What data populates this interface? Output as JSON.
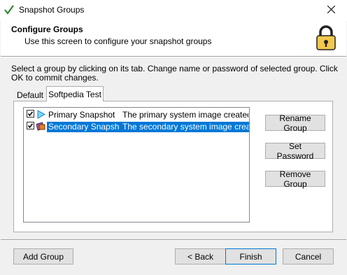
{
  "window": {
    "title": "Snapshot Groups",
    "close_icon": "close-icon",
    "app_icon": "checkmark-icon"
  },
  "header": {
    "title": "Configure Groups",
    "subtitle": "Use this screen to configure your snapshot groups",
    "icon": "lock-icon"
  },
  "instructions": "Select a group by clicking on its tab. Change name or password of selected group. Click OK to commit changes.",
  "tabs": [
    {
      "label": "Default",
      "selected": false
    },
    {
      "label": "Softpedia Test",
      "selected": true
    }
  ],
  "snapshots": [
    {
      "checked": true,
      "name": "Primary Snapshot",
      "description": "The primary system image created ...",
      "selected": false,
      "icon": "play-icon"
    },
    {
      "checked": true,
      "name": "Secondary Snapshot",
      "description": "The secondary system image creat...",
      "selected": true,
      "icon": "snapshot-icon"
    }
  ],
  "side_buttons": {
    "rename": "Rename Group",
    "set_password": "Set Password",
    "remove": "Remove Group"
  },
  "footer": {
    "add_group": "Add Group",
    "back": "< Back",
    "finish": "Finish",
    "cancel": "Cancel"
  },
  "colors": {
    "selection": "#0078d7",
    "accent": "#0078d7"
  }
}
